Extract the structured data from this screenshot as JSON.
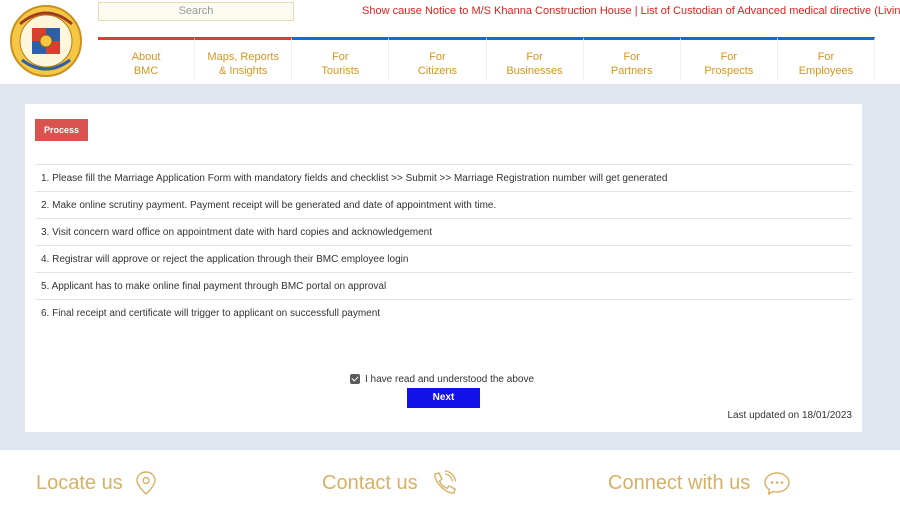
{
  "header": {
    "search_placeholder": "Search",
    "ticker": "Show cause Notice to M/S Khanna Construction House | List of Custodian of Advanced medical directive (Living Will )",
    "nav": [
      {
        "line1": "About",
        "line2": "BMC"
      },
      {
        "line1": "Maps, Reports",
        "line2": "& Insights"
      },
      {
        "line1": "For",
        "line2": "Tourists"
      },
      {
        "line1": "For",
        "line2": "Citizens"
      },
      {
        "line1": "For",
        "line2": "Businesses"
      },
      {
        "line1": "For",
        "line2": "Partners"
      },
      {
        "line1": "For",
        "line2": "Prospects"
      },
      {
        "line1": "For",
        "line2": "Employees"
      }
    ]
  },
  "main": {
    "process_label": "Process",
    "steps": [
      "1. Please fill the Marriage Application Form with mandatory fields and checklist >> Submit >> Marriage Registration number will get generated",
      "2. Make online scrutiny payment. Payment receipt will be generated and date of appointment with time.",
      "3. Visit concern ward office on appointment date with hard copies and acknowledgement",
      "4. Registrar will approve or reject the application through their BMC employee login",
      "5. Applicant has to make online final payment through BMC portal on approval",
      "6. Final receipt and certificate will trigger to applicant on successfull payment"
    ],
    "agree_label": "I have read and understood the above",
    "agree_checked": true,
    "next_label": "Next",
    "last_updated": "Last updated on 18/01/2023"
  },
  "footer": {
    "locate": "Locate us",
    "contact": "Contact us",
    "connect": "Connect with us"
  },
  "colors": {
    "accent_gold": "#d6941f",
    "ticker_red": "#e2211c",
    "process_red": "#d9544f",
    "next_blue": "#1212e8",
    "nav_blue": "#1b6ac9"
  }
}
